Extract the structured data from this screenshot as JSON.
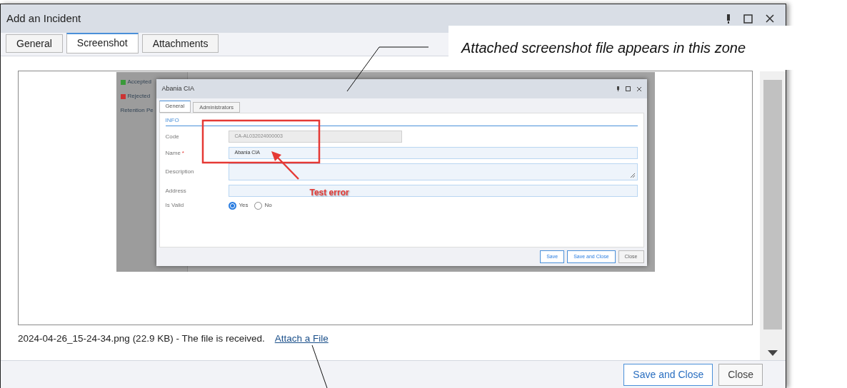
{
  "window": {
    "title": "Add an Incident"
  },
  "tabs": [
    {
      "label": "General",
      "selected": false
    },
    {
      "label": "Screenshot",
      "selected": true
    },
    {
      "label": "Attachments",
      "selected": false
    }
  ],
  "screenshot": {
    "background_items": [
      {
        "label": "Accepted",
        "color": "#3a9a3a"
      },
      {
        "label": "Rejected",
        "color": "#cc3333"
      },
      {
        "label": "Retention Pe"
      }
    ],
    "dialog": {
      "title": "Abania CIA",
      "tabs": [
        {
          "label": "General",
          "selected": true
        },
        {
          "label": "Administrators",
          "selected": false
        }
      ],
      "section": "INFO",
      "fields": [
        {
          "label": "Code",
          "kind": "text",
          "value": "CA-AL032024000003",
          "disabled": true
        },
        {
          "label": "Name",
          "required_mark": "*",
          "kind": "text",
          "value": "Abania CIA",
          "disabled": false
        },
        {
          "label": "Description",
          "kind": "textarea",
          "disabled": false
        },
        {
          "label": "Address",
          "kind": "text",
          "disabled": false
        },
        {
          "label": "Is Valid",
          "kind": "radio",
          "options": [
            {
              "label": "Yes",
              "selected": true
            },
            {
              "label": "No",
              "selected": false
            }
          ]
        }
      ],
      "buttons": [
        {
          "label": "Save",
          "kind": "primary"
        },
        {
          "label": "Save and Close",
          "kind": "primary"
        },
        {
          "label": "Close",
          "kind": "default"
        }
      ]
    },
    "annotation": "Test error"
  },
  "file_status": "2024-04-26_15-24-34.png (22.9 KB) - The file is received.",
  "attach_link": "Attach a File",
  "buttons": [
    {
      "label": "Save and Close",
      "kind": "primary"
    },
    {
      "label": "Close",
      "kind": "default"
    }
  ],
  "callout": "Attached screenshot file appears in this zone"
}
